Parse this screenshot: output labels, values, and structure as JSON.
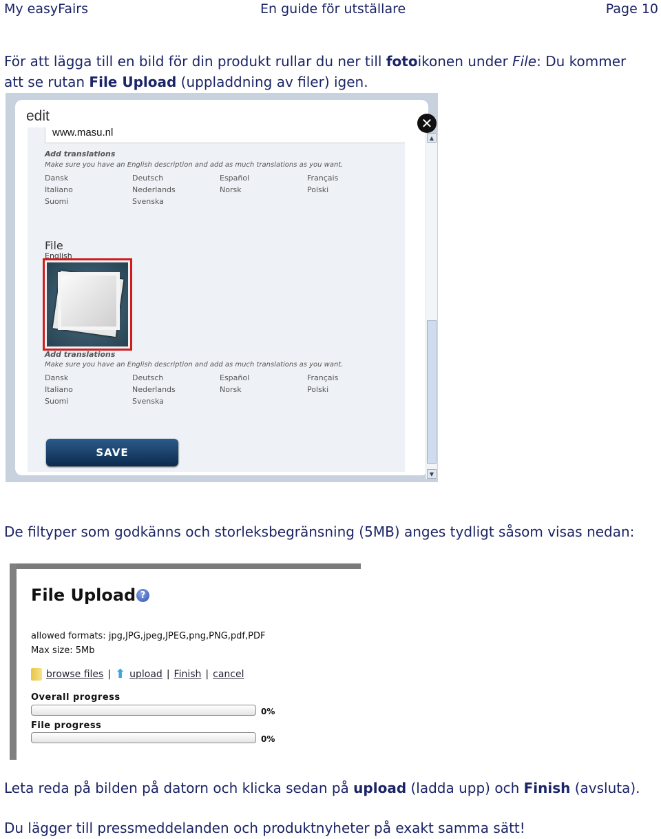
{
  "header": {
    "left": "My easyFairs",
    "center": "En guide för utställare",
    "right": "Page 10"
  },
  "para1": {
    "line1_a": "För att lägga till en bild för din produkt rullar du ner till ",
    "line1_b": "foto",
    "line1_c": "ikonen under ",
    "line1_d": "File",
    "line1_e": ": Du kommer",
    "line2_a": "att se rutan ",
    "line2_b": "File Upload",
    "line2_c": " (uppladdning av filer) igen."
  },
  "edit_dialog": {
    "title": "edit",
    "url_value": "www.masu.nl",
    "translations_heading": "Add translations",
    "translations_hint": "Make sure you have an English description and add as much translations as you want.",
    "languages": [
      "Dansk",
      "Deutsch",
      "Español",
      "Français",
      "Italiano",
      "Nederlands",
      "Norsk",
      "Polski",
      "Suomi",
      "Svenska"
    ],
    "file_heading": "File",
    "file_language": "English",
    "save_label": "SAVE",
    "close_icon": "close-icon",
    "highlight_color": "#d21c1c"
  },
  "para2": "De filtyper som godkänns och storleksbegränsning (5MB) anges tydligt såsom visas nedan:",
  "file_upload": {
    "title": "File Upload",
    "help_icon": "?",
    "allowed_formats": "allowed formats:  jpg,JPG,jpeg,JPEG,png,PNG,pdf,PDF",
    "max_size": "Max size:  5Mb",
    "links": {
      "browse": "browse files",
      "sep": "|",
      "upload": "upload",
      "finish": "Finish",
      "cancel": "cancel"
    },
    "overall_label": "Overall progress",
    "overall_pct": "0%",
    "overall_value": 0,
    "file_label": "File progress",
    "file_pct": "0%",
    "file_value": 0
  },
  "para3": {
    "a": "Leta reda på bilden på datorn och klicka sedan på ",
    "b": "upload",
    "c": " (ladda upp) och ",
    "d": "Finish",
    "e": " (avsluta)."
  },
  "para4": "Du lägger till pressmeddelanden och produktnyheter på exakt samma sätt!"
}
